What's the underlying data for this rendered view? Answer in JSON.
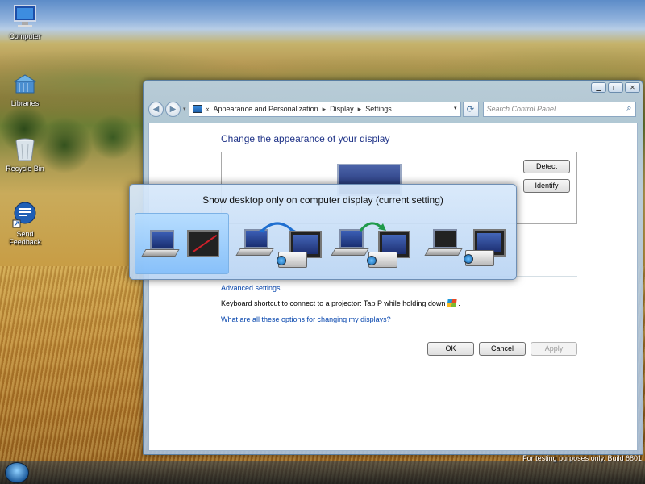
{
  "desktop": {
    "icons": [
      {
        "label": "Computer",
        "icon": "computer-icon"
      },
      {
        "label": "Libraries",
        "icon": "libraries-icon"
      },
      {
        "label": "Recycle Bin",
        "icon": "recycle-bin-icon"
      },
      {
        "label": "Send Feedback",
        "icon": "feedback-icon"
      }
    ],
    "watermark": "For testing purposes only. Build 6801"
  },
  "window": {
    "controls": {
      "minimize": "▁",
      "maximize": "□",
      "close": "✕"
    },
    "nav": {
      "back": "◀",
      "forward": "▶",
      "dropdown": "▾"
    },
    "address": {
      "prefix": "«",
      "crumbs": [
        "Appearance and Personalization",
        "Display",
        "Settings"
      ],
      "separator": "▸"
    },
    "refresh_icon": "⟳",
    "search": {
      "placeholder": "Search Control Panel",
      "icon": "search-icon"
    },
    "title": "Change the appearance of your display",
    "buttons": {
      "detect": "Detect",
      "identify": "Identify"
    },
    "advanced_link": "Advanced settings...",
    "shortcut_text": "Keyboard shortcut to connect to a projector: Tap P while holding down",
    "shortcut_suffix": ".",
    "help_link": "What are all these options for changing my displays?",
    "footer": {
      "ok": "OK",
      "cancel": "Cancel",
      "apply": "Apply"
    }
  },
  "popup": {
    "title": "Show desktop only on computer display (current setting)",
    "options": [
      {
        "name": "computer-only",
        "selected": true
      },
      {
        "name": "duplicate",
        "selected": false
      },
      {
        "name": "extend",
        "selected": false
      },
      {
        "name": "projector-only",
        "selected": false
      }
    ]
  },
  "colors": {
    "title_blue": "#1e3287",
    "link_blue": "#0645ad",
    "selection_blue": "#82bef5"
  }
}
